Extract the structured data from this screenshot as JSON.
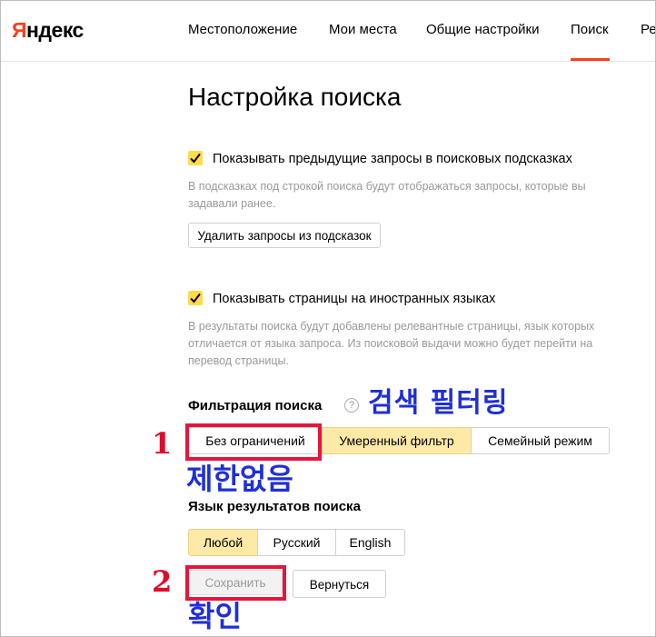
{
  "header": {
    "logo": {
      "first_letter": "Я",
      "rest": "ндекс"
    },
    "nav": [
      "Местоположение",
      "Мои места",
      "Общие настройки",
      "Поиск",
      "Ре"
    ],
    "active_nav": "Поиск"
  },
  "page": {
    "title": "Настройка поиска",
    "history": {
      "checked": true,
      "label": "Показывать предыдущие запросы в поисковых подсказках",
      "hint": "В подсказках под строкой поиска будут отображаться запросы, которые вы задавали ранее.",
      "clear_button": "Удалить запросы из подсказок"
    },
    "foreign": {
      "checked": true,
      "label": "Показывать страницы на иностранных языках",
      "hint": "В результаты поиска будут добавлены релевантные страницы, язык которых отличается от языка запроса. Из поисковой выдачи можно будет перейти на перевод страницы."
    },
    "filter": {
      "title": "Фильтрация поиска",
      "help": "?",
      "options": [
        "Без ограничений",
        "Умеренный фильтр",
        "Семейный режим"
      ],
      "selected": "Умеренный фильтр"
    },
    "language": {
      "title": "Язык результатов поиска",
      "options": [
        "Любой",
        "Русский",
        "English"
      ],
      "selected": "Любой"
    },
    "actions": {
      "save": "Сохранить",
      "back": "Вернуться"
    }
  },
  "annotations": {
    "filter_label_ko": "검색 필터링",
    "no_limit_ko": "제한없음",
    "confirm_ko": "확인",
    "step1": "1",
    "step2": "2",
    "accent_color": "#1f2fd8",
    "marker_color": "#e6153b"
  },
  "colors": {
    "brand_red": "#fc3f1d",
    "checkbox_yellow": "#ffdb4d",
    "segment_active": "#fee9a6"
  }
}
